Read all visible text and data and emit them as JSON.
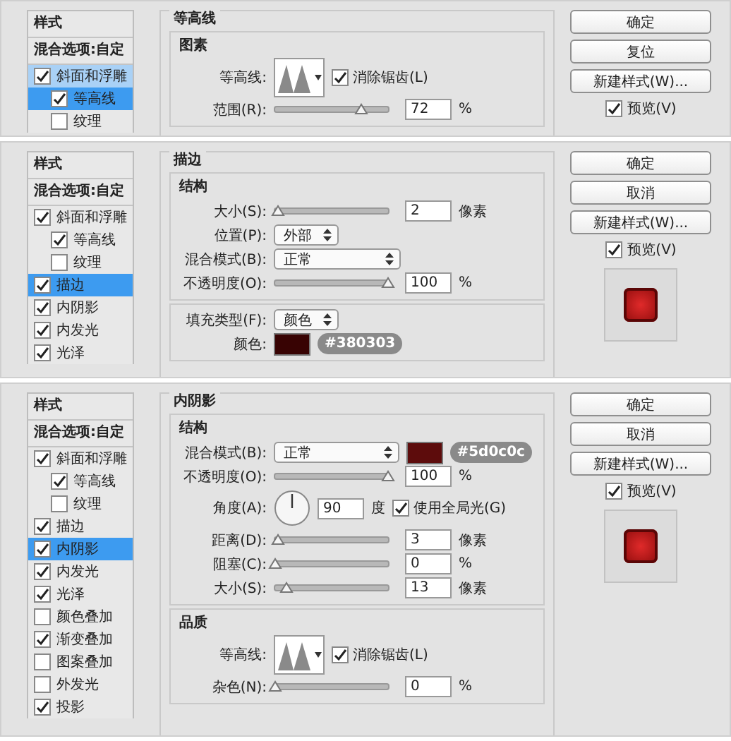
{
  "panels": [
    {
      "styles": [
        {
          "kind": "header",
          "label": "样式"
        },
        {
          "kind": "header",
          "label": "混合选项:自定"
        },
        {
          "kind": "check",
          "label": "斜面和浮雕",
          "checked": true,
          "selected": false,
          "highlighted": true,
          "children": [
            {
              "kind": "check",
              "label": "等高线",
              "checked": true,
              "selected": true,
              "highlighted": false
            },
            {
              "kind": "check",
              "label": "纹理",
              "checked": false,
              "selected": false,
              "highlighted": false
            }
          ]
        }
      ],
      "section": {
        "title": "等高线",
        "groups": [
          {
            "title": "图素",
            "rows": [
              {
                "kind": "contour",
                "label": "等高线:",
                "checkbox": {
                  "label": "消除锯齿(L)",
                  "checked": true
                }
              },
              {
                "kind": "slider",
                "label": "范围(R):",
                "level": 0.76,
                "value": "72",
                "unit": "%"
              }
            ]
          }
        ]
      },
      "buttons": [
        "确定",
        "复位",
        "新建样式(W)..."
      ],
      "preview": {
        "label": "预览(V)",
        "checked": true
      },
      "thumbnail": false
    },
    {
      "styles": [
        {
          "kind": "header",
          "label": "样式"
        },
        {
          "kind": "header",
          "label": "混合选项:自定"
        },
        {
          "kind": "check",
          "label": "斜面和浮雕",
          "checked": true,
          "selected": false,
          "highlighted": false,
          "children": [
            {
              "kind": "check",
              "label": "等高线",
              "checked": true,
              "selected": false,
              "highlighted": false
            },
            {
              "kind": "check",
              "label": "纹理",
              "checked": false,
              "selected": false,
              "highlighted": false
            }
          ]
        },
        {
          "kind": "check",
          "label": "描边",
          "checked": true,
          "selected": true,
          "highlighted": false
        },
        {
          "kind": "check",
          "label": "内阴影",
          "checked": true,
          "selected": false,
          "highlighted": false
        },
        {
          "kind": "check",
          "label": "内发光",
          "checked": true,
          "selected": false,
          "highlighted": false
        },
        {
          "kind": "check",
          "label": "光泽",
          "checked": true,
          "selected": false,
          "highlighted": false
        }
      ],
      "section": {
        "title": "描边",
        "groups": [
          {
            "title": "结构",
            "rows": [
              {
                "kind": "slider",
                "label": "大小(S):",
                "level": 0.02,
                "value": "2",
                "unit": "像素"
              },
              {
                "kind": "select",
                "label": "位置(P):",
                "value": "外部"
              },
              {
                "kind": "mode",
                "label": "混合模式(B):",
                "value": "正常"
              },
              {
                "kind": "slider",
                "label": "不透明度(O):",
                "level": 1,
                "value": "100",
                "unit": "%"
              }
            ]
          },
          {
            "rows": [
              {
                "kind": "select",
                "label": "填充类型(F):",
                "value": "颜色"
              },
              {
                "kind": "color",
                "label": "颜色:",
                "color": "#380303",
                "hex": "#380303"
              }
            ]
          }
        ]
      },
      "buttons": [
        "确定",
        "取消",
        "新建样式(W)..."
      ],
      "preview": {
        "label": "预览(V)",
        "checked": true
      },
      "thumbnail": true
    },
    {
      "styles": [
        {
          "kind": "header",
          "label": "样式"
        },
        {
          "kind": "header",
          "label": "混合选项:自定"
        },
        {
          "kind": "check",
          "label": "斜面和浮雕",
          "checked": true,
          "selected": false,
          "highlighted": false,
          "children": [
            {
              "kind": "check",
              "label": "等高线",
              "checked": true,
              "selected": false,
              "highlighted": false
            },
            {
              "kind": "check",
              "label": "纹理",
              "checked": false,
              "selected": false,
              "highlighted": false
            }
          ]
        },
        {
          "kind": "check",
          "label": "描边",
          "checked": true,
          "selected": false,
          "highlighted": false
        },
        {
          "kind": "check",
          "label": "内阴影",
          "checked": true,
          "selected": true,
          "highlighted": false
        },
        {
          "kind": "check",
          "label": "内发光",
          "checked": true,
          "selected": false,
          "highlighted": false
        },
        {
          "kind": "check",
          "label": "光泽",
          "checked": true,
          "selected": false,
          "highlighted": false
        },
        {
          "kind": "check",
          "label": "颜色叠加",
          "checked": false,
          "selected": false,
          "highlighted": false
        },
        {
          "kind": "check",
          "label": "渐变叠加",
          "checked": true,
          "selected": false,
          "highlighted": false
        },
        {
          "kind": "check",
          "label": "图案叠加",
          "checked": false,
          "selected": false,
          "highlighted": false
        },
        {
          "kind": "check",
          "label": "外发光",
          "checked": false,
          "selected": false,
          "highlighted": false
        },
        {
          "kind": "check",
          "label": "投影",
          "checked": true,
          "selected": false,
          "highlighted": false
        }
      ],
      "section": {
        "title": "内阴影",
        "groups": [
          {
            "title": "结构",
            "rows": [
              {
                "kind": "mode",
                "label": "混合模式(B):",
                "value": "正常",
                "color": "#5d0c0c",
                "hex": "#5d0c0c"
              },
              {
                "kind": "slider",
                "label": "不透明度(O):",
                "level": 1,
                "value": "100",
                "unit": "%"
              },
              {
                "kind": "angle",
                "label": "角度(A):",
                "value": "90",
                "unit": "度",
                "checkbox": {
                  "label": "使用全局光(G)",
                  "checked": true
                }
              },
              {
                "kind": "slider",
                "label": "距离(D):",
                "level": 0.03,
                "value": "3",
                "unit": "像素"
              },
              {
                "kind": "slider",
                "label": "阻塞(C):",
                "level": 0,
                "value": "0",
                "unit": "%"
              },
              {
                "kind": "slider",
                "label": "大小(S):",
                "level": 0.1,
                "value": "13",
                "unit": "像素"
              }
            ]
          },
          {
            "title": "品质",
            "rows": [
              {
                "kind": "contour",
                "label": "等高线:",
                "checkbox": {
                  "label": "消除锯齿(L)",
                  "checked": true
                }
              },
              {
                "kind": "slider",
                "label": "杂色(N):",
                "level": 0,
                "value": "0",
                "unit": "%"
              }
            ]
          }
        ]
      },
      "buttons": [
        "确定",
        "取消",
        "新建样式(W)..."
      ],
      "preview": {
        "label": "预览(V)",
        "checked": true
      },
      "thumbnail": true
    }
  ]
}
